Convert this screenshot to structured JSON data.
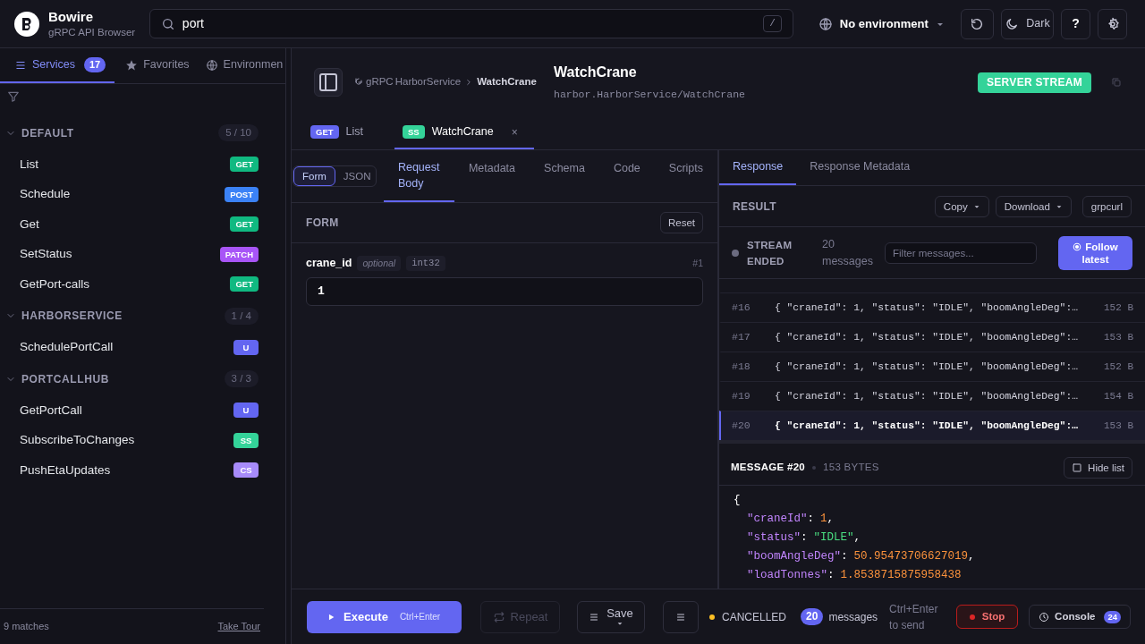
{
  "app": {
    "name": "Bowire",
    "subtitle": "gRPC API Browser"
  },
  "search": {
    "value": "port",
    "shortcut": "/"
  },
  "environment": {
    "label": "No environment"
  },
  "theme_button": "Dark",
  "help_button": "?",
  "sidebar": {
    "tabs": [
      {
        "label": "Services",
        "count": "17",
        "selected": true
      },
      {
        "label": "Favorites",
        "selected": false
      },
      {
        "label": "Environmen",
        "selected": false
      }
    ],
    "groups": [
      {
        "name": "DEFAULT",
        "count": "5 / 10",
        "expanded": true,
        "items": [
          {
            "name": "List",
            "method": "GET",
            "color": "#10b981"
          },
          {
            "name": "Schedule",
            "method": "POST",
            "color": "#3b82f6"
          },
          {
            "name": "Get",
            "method": "GET",
            "color": "#10b981"
          },
          {
            "name": "SetStatus",
            "method": "PATCH",
            "color": "#a855f7"
          },
          {
            "name": "GetPort-calls",
            "method": "GET",
            "color": "#10b981"
          }
        ]
      },
      {
        "name": "HARBORSERVICE",
        "count": "1 / 4",
        "expanded": true,
        "items": [
          {
            "name": "SchedulePortCall",
            "method": "U",
            "color": "#6366f1"
          }
        ]
      },
      {
        "name": "PORTCALLHUB",
        "count": "3 / 3",
        "expanded": true,
        "items": [
          {
            "name": "GetPortCall",
            "method": "U",
            "color": "#6366f1"
          },
          {
            "name": "SubscribeToChanges",
            "method": "SS",
            "color": "#34d399"
          },
          {
            "name": "PushEtaUpdates",
            "method": "CS",
            "color": "#a78bfa"
          }
        ]
      }
    ],
    "matches": "9 matches",
    "tour": "Take Tour"
  },
  "method": {
    "protocol": "gRPC",
    "service": "HarborService",
    "name": "WatchCrane",
    "title": "WatchCrane",
    "path": "harbor.HarborService/WatchCrane",
    "type": "SERVER STREAM"
  },
  "open_tabs": [
    {
      "badge": "GET",
      "color": "#6366f1",
      "label": "List",
      "selected": false
    },
    {
      "badge": "SS",
      "color": "#34d399",
      "label": "WatchCrane",
      "selected": true,
      "close": "×"
    }
  ],
  "request": {
    "modes": [
      {
        "label": "Form",
        "selected": true
      },
      {
        "label": "JSON",
        "selected": false
      }
    ],
    "tabs": [
      {
        "label": "Request Body",
        "selected": true
      },
      {
        "label": "Metadata",
        "selected": false
      },
      {
        "label": "Schema",
        "selected": false
      },
      {
        "label": "Code",
        "selected": false
      },
      {
        "label": "Scripts",
        "selected": false
      }
    ],
    "section": "FORM",
    "reset": "Reset",
    "fields": [
      {
        "name": "crane_id",
        "qualifier": "optional",
        "type": "int32",
        "number": "#1",
        "value": "1"
      }
    ]
  },
  "response": {
    "tabs": [
      {
        "label": "Response",
        "selected": true
      },
      {
        "label": "Response Metadata",
        "selected": false
      }
    ],
    "section": "RESULT",
    "actions": [
      {
        "label": "Copy",
        "caret": true
      },
      {
        "label": "Download",
        "caret": true
      },
      {
        "label": "grpcurl",
        "caret": false
      }
    ],
    "stream": {
      "status": "STREAM ENDED",
      "count": "20",
      "count_label": "messages",
      "filter_placeholder": "Filter messages...",
      "follow": "Follow latest"
    },
    "messages": [
      {
        "index": "#16",
        "preview": "{ \"craneId\": 1, \"status\": \"IDLE\", \"boomAngleDeg\":…",
        "size": "152 B",
        "selected": false
      },
      {
        "index": "#17",
        "preview": "{ \"craneId\": 1, \"status\": \"IDLE\", \"boomAngleDeg\":…",
        "size": "153 B",
        "selected": false
      },
      {
        "index": "#18",
        "preview": "{ \"craneId\": 1, \"status\": \"IDLE\", \"boomAngleDeg\":…",
        "size": "152 B",
        "selected": false
      },
      {
        "index": "#19",
        "preview": "{ \"craneId\": 1, \"status\": \"IDLE\", \"boomAngleDeg\":…",
        "size": "154 B",
        "selected": false
      },
      {
        "index": "#20",
        "preview": "{ \"craneId\": 1, \"status\": \"IDLE\", \"boomAngleDeg\":…",
        "size": "153 B",
        "selected": true
      }
    ],
    "detail": {
      "title": "MESSAGE #20",
      "size": "153 BYTES",
      "hide": "Hide list",
      "open": "{",
      "lines": [
        {
          "key": "\"craneId\"",
          "sep": ":",
          "value": "1",
          "kind": "number",
          "punct": ","
        },
        {
          "key": "\"status\"",
          "sep": ":",
          "value": "\"IDLE\"",
          "kind": "string",
          "punct": ","
        },
        {
          "key": "\"boomAngleDeg\"",
          "sep": ":",
          "value": "50.95473706627019",
          "kind": "number",
          "punct": ","
        },
        {
          "key": "\"loadTonnes\"",
          "sep": ":",
          "value": "1.8538715875958438",
          "kind": "number"
        }
      ]
    }
  },
  "bottom": {
    "execute": "Execute",
    "execute_shortcut": "Ctrl+Enter",
    "repeat": "Repeat",
    "repeat_disabled": true,
    "save": "Save",
    "status": "CANCELLED",
    "message_count": "20",
    "message_label": "messages",
    "hint": "Ctrl+Enter to send",
    "stop": "Stop",
    "console": "Console",
    "console_count": "24"
  }
}
